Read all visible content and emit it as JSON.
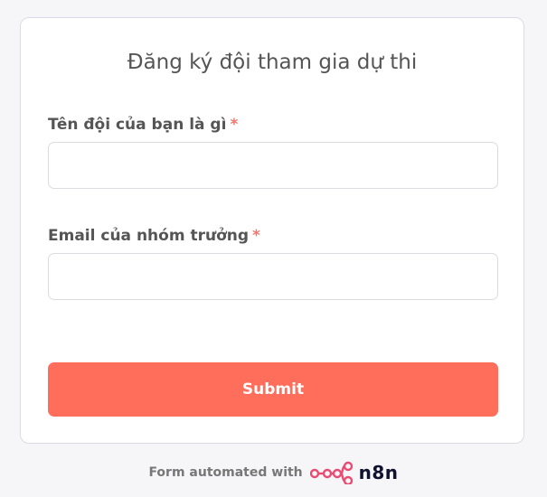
{
  "form": {
    "title": "Đăng ký đội tham gia dự thi",
    "fields": [
      {
        "label": "Tên đội của bạn là gì",
        "required_mark": "*",
        "value": "",
        "placeholder": ""
      },
      {
        "label": "Email của nhóm trưởng",
        "required_mark": "*",
        "value": "",
        "placeholder": ""
      }
    ],
    "submit_label": "Submit"
  },
  "footer": {
    "text": "Form automated with",
    "brand_name": "n8n",
    "brand_icon": "n8n-logo-icon"
  },
  "colors": {
    "accent": "#ff6d5b",
    "required": "#f2766f",
    "brand_icon": "#ea4b71",
    "text": "#555555",
    "background": "#f6f6f9"
  }
}
